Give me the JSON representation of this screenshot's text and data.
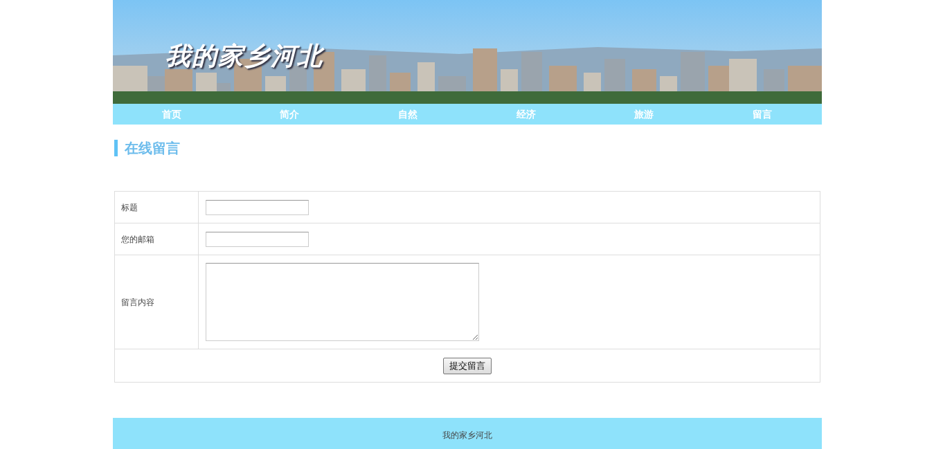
{
  "banner": {
    "title": "我的家乡河北"
  },
  "nav": [
    {
      "label": "首页"
    },
    {
      "label": "简介"
    },
    {
      "label": "自然"
    },
    {
      "label": "经济"
    },
    {
      "label": "旅游"
    },
    {
      "label": "留言"
    }
  ],
  "heading": "在线留言",
  "form": {
    "fields": [
      {
        "label": "标题",
        "kind": "input"
      },
      {
        "label": "您的邮箱",
        "kind": "input"
      },
      {
        "label": "留言内容",
        "kind": "textarea"
      }
    ],
    "submit": "提交留言"
  },
  "footer": "我的家乡河北"
}
